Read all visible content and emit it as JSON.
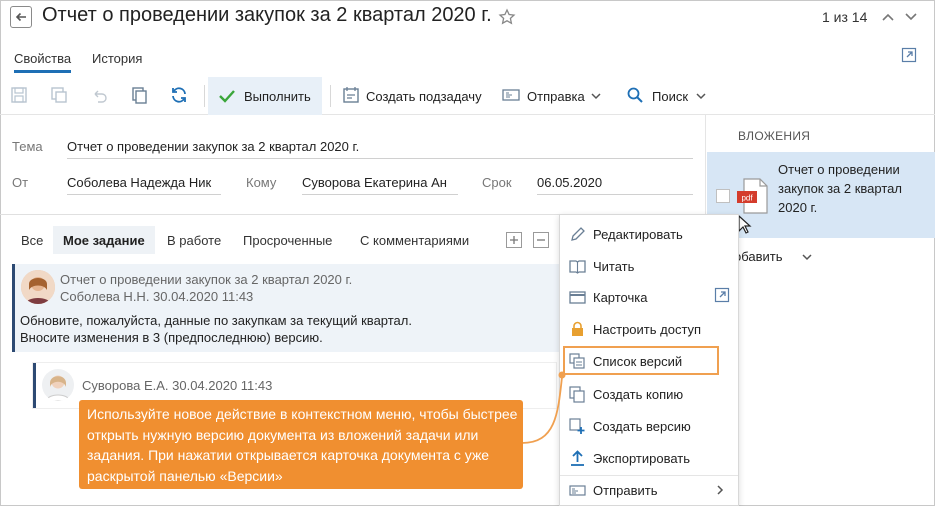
{
  "header": {
    "title": "Отчет о проведении закупок за 2 квартал 2020 г.",
    "pager": "1 из 14"
  },
  "tabs": [
    {
      "label": "Свойства",
      "active": true
    },
    {
      "label": "История",
      "active": false
    }
  ],
  "toolbar": {
    "execute_label": "Выполнить",
    "create_subtask_label": "Создать подзадачу",
    "send_label": "Отправка",
    "search_label": "Поиск"
  },
  "fields": {
    "subject_label": "Тема",
    "subject_value": "Отчет о проведении закупок за 2 квартал 2020 г.",
    "from_label": "От",
    "from_value": "Соболева Надежда Ник",
    "to_label": "Кому",
    "to_value": "Суворова Екатерина Ан",
    "due_label": "Срок",
    "due_value": "06.05.2020"
  },
  "attachments": {
    "title": "ВЛОЖЕНИЯ",
    "item_name": "Отчет о проведении закупок за 2 квартал 2020 г.",
    "add_label": "обавить"
  },
  "filter_tabs": [
    {
      "label": "Все",
      "active": false
    },
    {
      "label": "Мое задание",
      "active": true
    },
    {
      "label": "В работе",
      "active": false
    },
    {
      "label": "Просроченные",
      "active": false
    },
    {
      "label": "С комментариями",
      "active": false
    }
  ],
  "messages": [
    {
      "subject": "Отчет о проведении закупок за 2 квартал 2020 г.",
      "author_date": "Соболева Н.Н.  30.04.2020 11:43",
      "line1": "Обновите, пожалуйста, данные по закупкам за текущий квартал.",
      "line2": "Вносите изменения в 3 (предпоследнюю) версию."
    },
    {
      "author_date": "Суворова Е.А.  30.04.2020 11:43"
    }
  ],
  "context_menu": {
    "items": [
      {
        "label": "Редактировать",
        "icon": "pencil-icon"
      },
      {
        "label": "Читать",
        "icon": "book-icon"
      },
      {
        "label": "Карточка",
        "icon": "card-icon"
      },
      {
        "label": "Настроить доступ",
        "icon": "lock-icon"
      },
      {
        "label": "Список версий",
        "icon": "versions-icon",
        "highlighted": true
      },
      {
        "label": "Создать копию",
        "icon": "copy-icon"
      },
      {
        "label": "Создать версию",
        "icon": "new-version-icon"
      },
      {
        "label": "Экспортировать",
        "icon": "export-icon"
      },
      {
        "label": "Отправить",
        "icon": "send-icon"
      }
    ]
  },
  "callout": {
    "text": "Используйте новое действие в контекстном меню, чтобы быстрее открыть нужную версию документа из вложений задачи или задания. При нажатии открывается карточка документа с уже раскрытой панелью «Версии»"
  },
  "colors": {
    "accent": "#1e6fb5",
    "callout": "#f08f30",
    "attachment_selected": "#d7e6f5",
    "message_border": "#2d4a73"
  }
}
